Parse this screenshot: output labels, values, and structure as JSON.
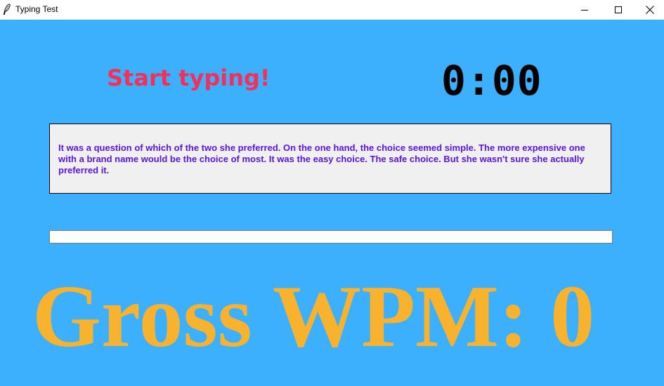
{
  "window": {
    "title": "Typing Test",
    "icon": "feather-icon",
    "controls": {
      "minimize_icon": "minimize-icon",
      "maximize_icon": "maximize-icon",
      "close_icon": "close-icon"
    }
  },
  "main": {
    "status": "Start typing!",
    "timer": "0:00",
    "passage": "It was a question of which of the two she preferred. On the one hand, the choice seemed simple. The more expensive one with a brand name would be the choice of most. It was the easy choice. The safe choice. But she wasn't sure she actually preferred it.",
    "input_value": "",
    "wpm_text": "Gross WPM: 0"
  },
  "colors": {
    "background": "#3caffd",
    "status": "#f2305a",
    "passage_text": "#5b14e6",
    "wpm": "#f8b22e"
  }
}
